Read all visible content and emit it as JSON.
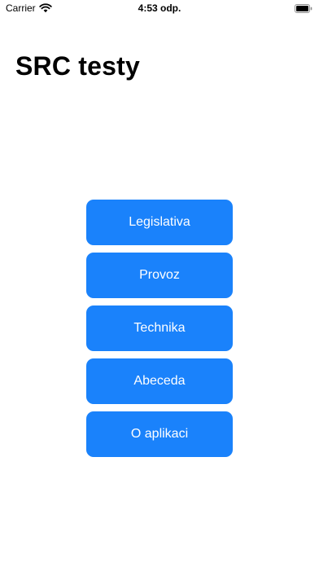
{
  "status_bar": {
    "carrier": "Carrier",
    "time": "4:53 odp.",
    "icons": {
      "wifi": "wifi-icon",
      "battery": "battery-icon"
    }
  },
  "header": {
    "title": "SRC testy"
  },
  "menu": {
    "accent_color": "#1a82fb",
    "items": [
      {
        "label": "Legislativa"
      },
      {
        "label": "Provoz"
      },
      {
        "label": "Technika"
      },
      {
        "label": "Abeceda"
      },
      {
        "label": "O aplikaci"
      }
    ]
  }
}
